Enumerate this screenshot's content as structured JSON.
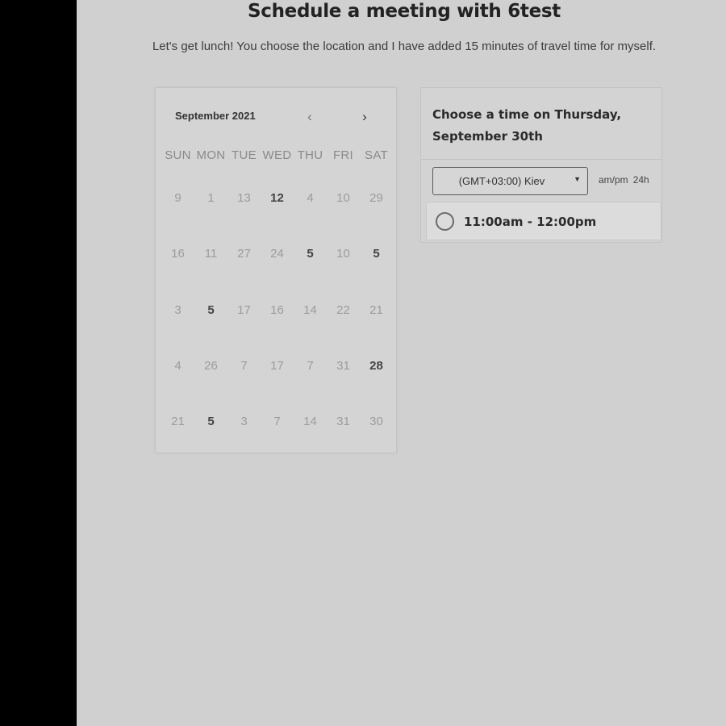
{
  "header": {
    "title": "Schedule a meeting with 6test",
    "subtitle": "Let's get lunch! You choose the location and I have added 15 minutes of travel time for myself."
  },
  "calendar": {
    "month_label": "September 2021",
    "prev_icon": "chevron-left-icon",
    "next_icon": "chevron-right-icon",
    "weekdays": [
      "SUN",
      "MON",
      "TUE",
      "WED",
      "THU",
      "FRI",
      "SAT"
    ],
    "weeks": [
      [
        {
          "d": "9"
        },
        {
          "d": "1"
        },
        {
          "d": "13"
        },
        {
          "d": "12",
          "available": true
        },
        {
          "d": "4"
        },
        {
          "d": "10"
        },
        {
          "d": "29"
        }
      ],
      [
        {
          "d": "16"
        },
        {
          "d": "11"
        },
        {
          "d": "27"
        },
        {
          "d": "24"
        },
        {
          "d": "5",
          "available": true
        },
        {
          "d": "10"
        },
        {
          "d": "5",
          "available": true
        }
      ],
      [
        {
          "d": "3"
        },
        {
          "d": "5",
          "available": true
        },
        {
          "d": "17"
        },
        {
          "d": "16"
        },
        {
          "d": "14"
        },
        {
          "d": "22"
        },
        {
          "d": "21"
        }
      ],
      [
        {
          "d": "4"
        },
        {
          "d": "26"
        },
        {
          "d": "7"
        },
        {
          "d": "17"
        },
        {
          "d": "7"
        },
        {
          "d": "31"
        },
        {
          "d": "28",
          "available": true
        }
      ],
      [
        {
          "d": "21"
        },
        {
          "d": "5",
          "available": true
        },
        {
          "d": "3"
        },
        {
          "d": "7"
        },
        {
          "d": "14"
        },
        {
          "d": "31"
        },
        {
          "d": "30"
        }
      ]
    ]
  },
  "times": {
    "heading": "Choose a time on Thursday, September 30th",
    "timezone": "(GMT+03:00) Kiev",
    "format_ampm": "am/pm",
    "format_24h": "24h",
    "slots": [
      {
        "label": "11:00am - 12:00pm"
      }
    ]
  }
}
